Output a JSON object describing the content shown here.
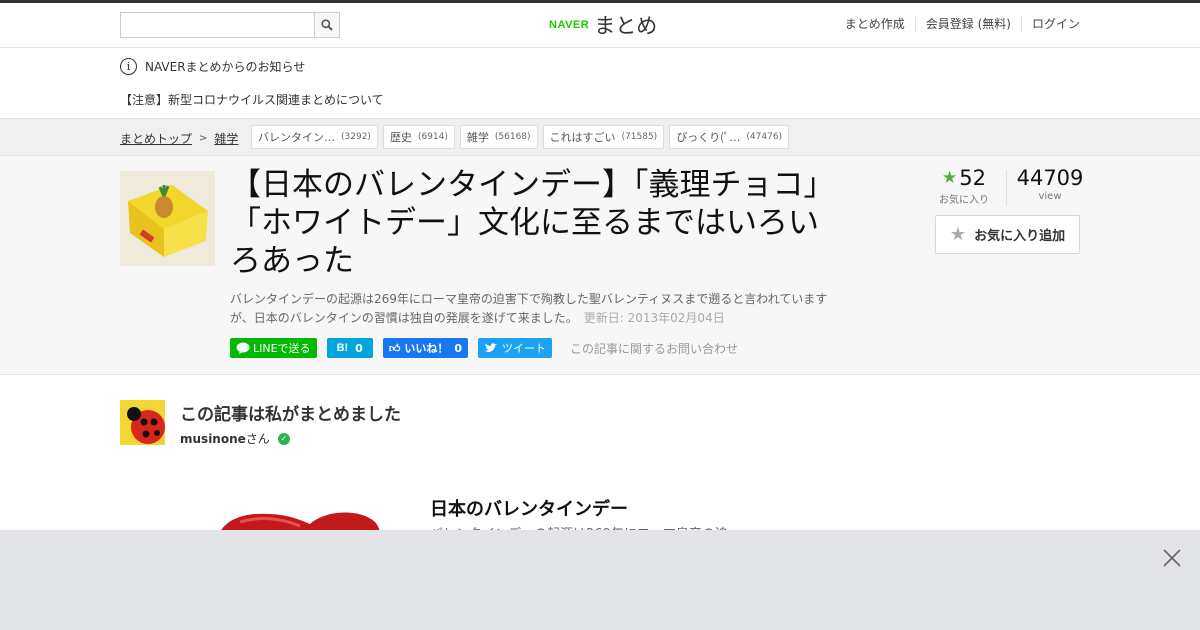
{
  "header": {
    "search_placeholder": "",
    "logo_brand": "NAVER",
    "logo_text": "まとめ",
    "nav": [
      "まとめ作成",
      "会員登録 (無料)",
      "ログイン"
    ]
  },
  "notice": {
    "title": "NAVERまとめからのお知らせ",
    "link": "【注意】新型コロナウイルス関連まとめについて"
  },
  "breadcrumb": {
    "home": "まとめトップ",
    "category": "雑学",
    "tags": [
      {
        "label": "バレンタイン…",
        "count": "(3292)"
      },
      {
        "label": "歴史",
        "count": "(6914)"
      },
      {
        "label": "雑学",
        "count": "(56168)"
      },
      {
        "label": "これはすごい",
        "count": "(71585)"
      },
      {
        "label": "びっくり(ﾟ…",
        "count": "(47476)"
      }
    ]
  },
  "article": {
    "title": "【日本のバレンタインデー】「義理チョコ」「ホワイトデー」文化に至るまではいろいろあった",
    "description": "バレンタインデーの起源は269年にローマ皇帝の迫害下で殉教した聖バレンティヌスまで遡ると言われていますが、日本のバレンタインの習慣は独自の発展を遂げて来ました。",
    "updated": "更新日: 2013年02月04日",
    "favorites": "52",
    "favorites_label": "お気に入り",
    "views": "44709",
    "views_label": "view",
    "fav_button": "お気に入り追加",
    "contact": "この記事に関するお問い合わせ"
  },
  "share": {
    "line": "LINEで送る",
    "hatena_count": "0",
    "fb_label": "いいね！",
    "fb_count": "0",
    "tweet": "ツイート"
  },
  "author": {
    "heading": "この記事は私がまとめました",
    "name": "musinone",
    "suffix": "さん"
  },
  "item": {
    "title": "日本のバレンタインデー",
    "text": "バレンタインデーの起源は269年にローマ皇帝の迫"
  },
  "colors": {
    "naver_green": "#1ec800",
    "star_green": "#4ab336",
    "line": "#00b900",
    "hatena": "#00a4de",
    "facebook": "#1877f2",
    "twitter": "#1da1f2",
    "overlay": "#e2e4e7"
  },
  "icons": [
    "search-icon",
    "info-icon",
    "chevron-right-icon",
    "star-icon",
    "close-icon",
    "verified-icon"
  ]
}
